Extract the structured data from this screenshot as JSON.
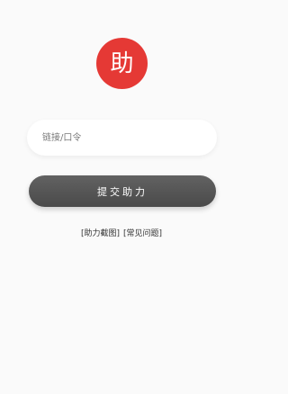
{
  "logo": {
    "char": "助",
    "color": "#e53935"
  },
  "form": {
    "placeholder": "链接/口令",
    "value": ""
  },
  "submit": {
    "label": "提交助力"
  },
  "links": {
    "screenshot": "[助力截图]",
    "faq": "[常见问题]"
  }
}
